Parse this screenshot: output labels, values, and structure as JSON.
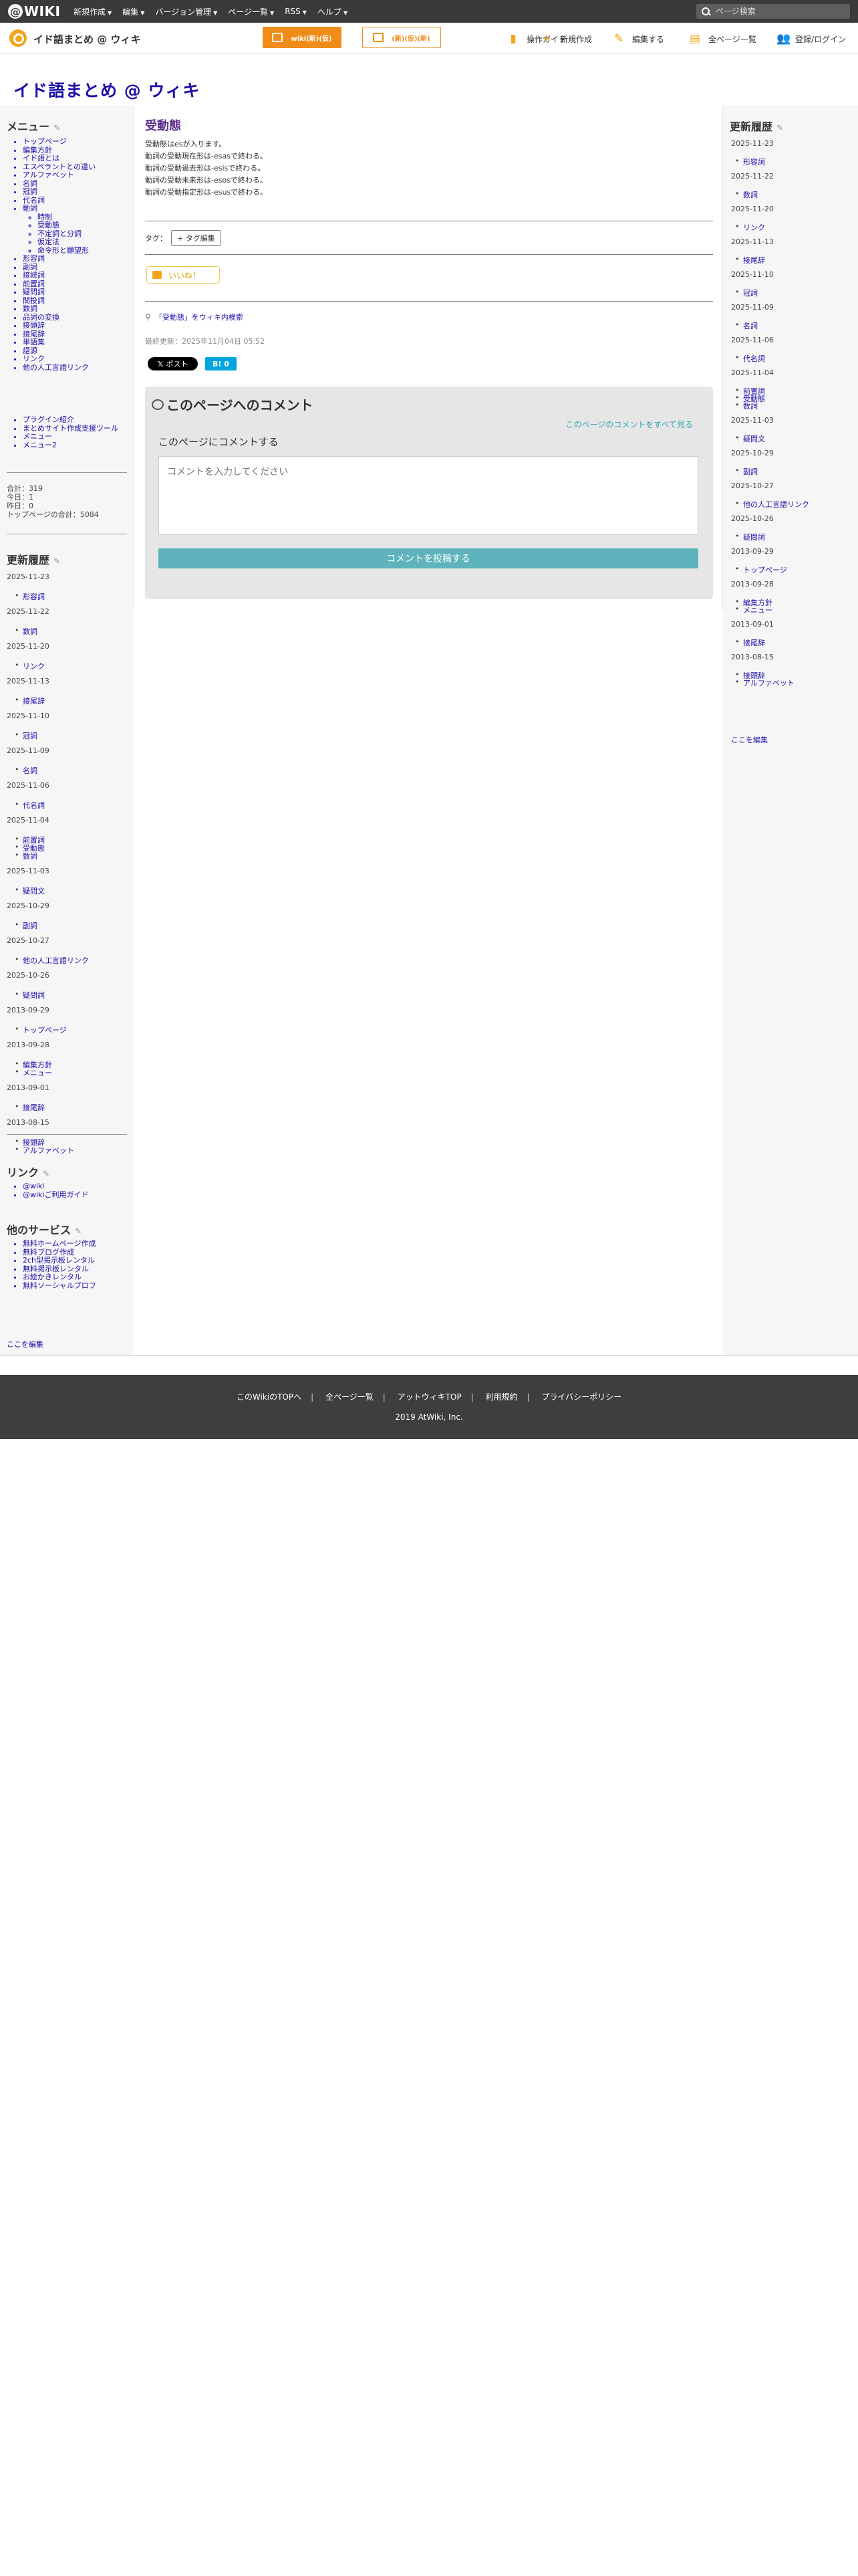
{
  "topbar": {
    "logo_text": "WIKI",
    "menu": [
      "新規作成",
      "編集",
      "バージョン管理",
      "ページ一覧",
      "RSS",
      "ヘルプ"
    ],
    "search_placeholder": "ページ検索"
  },
  "sitebar": {
    "name": "イド語まとめ @ ウィキ",
    "btn_edit": "wiki(新)(仮)",
    "btn_ad": "(新)(仮)(新)",
    "tools": [
      "操作ガイド",
      "新規作成",
      "編集する",
      "全ページ一覧",
      "登録/ログイン"
    ],
    "accent": "#f08c18"
  },
  "page_title": "イド語まとめ @ ウィキ",
  "left": {
    "menu_title": "メニュー",
    "menu_items": [
      "トップページ",
      "編集方針",
      "イド語とは",
      "エスペラントとの違い",
      "アルファベット",
      "名詞",
      "冠詞",
      "代名詞",
      "動詞"
    ],
    "verb_sub": [
      "時制",
      "受動態",
      "不定詞と分詞",
      "仮定法",
      "命令形と願望形"
    ],
    "menu_items2": [
      "形容詞",
      "副詞",
      "接続詞",
      "前置詞",
      "疑問詞",
      "間投詞",
      "数詞",
      "品詞の変換",
      "接頭辞",
      "接尾辞",
      "単語集",
      "語源",
      "リンク",
      "他の人工言語リンク"
    ],
    "extra_items": [
      "プラグイン紹介",
      "まとめサイト作成支援ツール",
      "メニュー",
      "メニュー2"
    ],
    "stats": [
      "合計：319",
      "今日：1",
      "昨日：0",
      "トップページの合計：5084"
    ],
    "history_title": "更新履歴",
    "history": [
      {
        "date": "2025-11-23",
        "items": [
          "形容詞"
        ]
      },
      {
        "date": "2025-11-22",
        "items": [
          "数詞"
        ]
      },
      {
        "date": "2025-11-20",
        "items": [
          "リンク"
        ]
      },
      {
        "date": "2025-11-13",
        "items": [
          "接尾辞"
        ]
      },
      {
        "date": "2025-11-10",
        "items": [
          "冠詞"
        ]
      },
      {
        "date": "2025-11-09",
        "items": [
          "名詞"
        ]
      },
      {
        "date": "2025-11-06",
        "items": [
          "代名詞"
        ]
      },
      {
        "date": "2025-11-04",
        "items": [
          "前置詞",
          "受動態",
          "数詞"
        ]
      },
      {
        "date": "2025-11-03",
        "items": [
          "疑問文"
        ]
      },
      {
        "date": "2025-10-29",
        "items": [
          "副詞"
        ]
      },
      {
        "date": "2025-10-27",
        "items": [
          "他の人工言語リンク"
        ]
      },
      {
        "date": "2025-10-26",
        "items": [
          "疑問詞"
        ]
      },
      {
        "date": "2013-09-29",
        "items": [
          "トップページ"
        ]
      },
      {
        "date": "2013-09-28",
        "items": [
          "編集方針",
          "メニュー"
        ]
      },
      {
        "date": "2013-09-01",
        "items": [
          "接尾辞"
        ]
      },
      {
        "date": "2013-08-15",
        "items": [
          "接頭辞",
          "アルファベット"
        ]
      }
    ],
    "links_title": "リンク",
    "links": [
      "@wiki",
      "@wikiご利用ガイド"
    ],
    "services_title": "他のサービス",
    "services": [
      "無料ホームページ作成",
      "無料ブログ作成",
      "2ch型掲示板レンタル",
      "無料掲示板レンタル",
      "お絵かきレンタル",
      "無料ソーシャルプロフ"
    ],
    "edit_here": "ここを編集"
  },
  "main": {
    "heading": "受動態",
    "lines": [
      "受動態はesが入ります。",
      "動詞の受動現在形は-esasで終わる。",
      "動詞の受動過去形は-esisで終わる。",
      "動詞の受動未来形は-esosで終わる。",
      "動詞の受動指定形は-esusで終わる。"
    ],
    "tag_label": "タグ：",
    "tag_button": "+ タグ編集",
    "like": "いいね！",
    "wiki_search": "「受動態」をウィキ内検索",
    "updated": "最終更新：2025年11月04日 05:52",
    "x_post": "ポスト",
    "hatena": "B! 0",
    "comment_title": "このページへのコメント",
    "comment_all": "このページのコメントをすべて見る",
    "comment_label": "このページにコメントする",
    "comment_placeholder": "コメントを入力してください",
    "comment_submit": "コメントを投稿する"
  },
  "right": {
    "history_title": "更新履歴",
    "edit_here": "ここを編集"
  },
  "footer": {
    "links": [
      "このWikiのTOPへ",
      "全ページ一覧",
      "アットウィキTOP",
      "利用規約",
      "プライバシーポリシー"
    ],
    "copyright": "2019 AtWiki, Inc."
  }
}
